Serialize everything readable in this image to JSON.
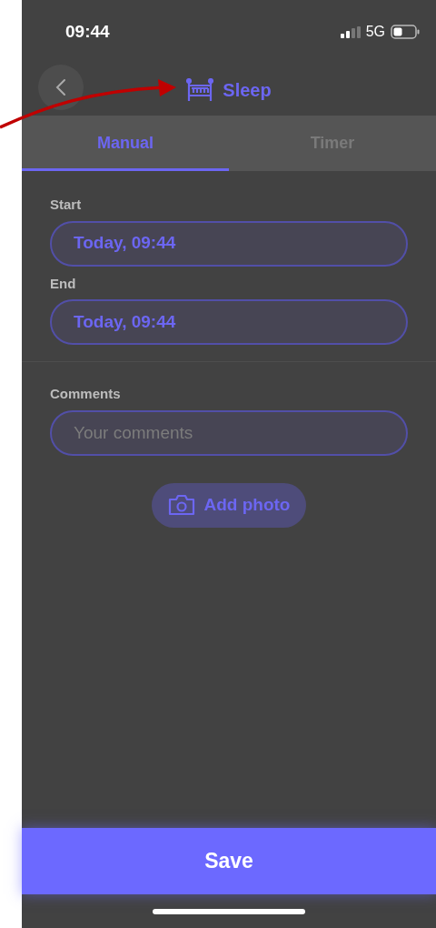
{
  "status_bar": {
    "time": "09:44",
    "network": "5G"
  },
  "header": {
    "title": "Sleep"
  },
  "tabs": [
    {
      "label": "Manual",
      "selected": true
    },
    {
      "label": "Timer",
      "selected": false
    }
  ],
  "fields": [
    {
      "label": "Start",
      "value": "Today, 09:44"
    },
    {
      "label": "End",
      "value": "Today, 09:44"
    }
  ],
  "comments": {
    "label": "Comments",
    "placeholder": "Your comments"
  },
  "add_photo": {
    "label": "Add photo"
  },
  "save_button": {
    "label": "Save"
  }
}
